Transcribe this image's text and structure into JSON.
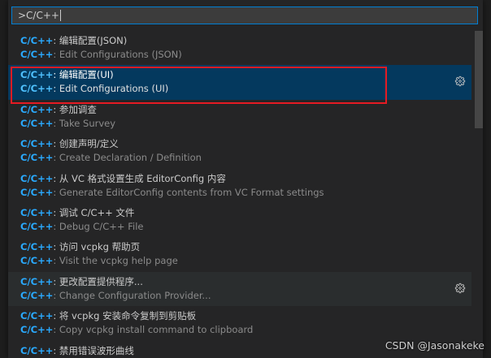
{
  "search": {
    "value": ">C/C++"
  },
  "items": [
    {
      "prefix": "C/C++",
      "title": ": 编辑配置(JSON)",
      "detail": ": Edit Configurations (JSON)",
      "state": "normal",
      "gear": false
    },
    {
      "prefix": "C/C++",
      "title": ": 编辑配置(UI)",
      "detail": ": Edit Configurations (UI)",
      "state": "selected",
      "gear": true
    },
    {
      "prefix": "C/C++",
      "title": ": 参加调查",
      "detail": ": Take Survey",
      "state": "normal",
      "gear": false
    },
    {
      "prefix": "C/C++",
      "title": ": 创建声明/定义",
      "detail": ": Create Declaration / Definition",
      "state": "normal",
      "gear": false
    },
    {
      "prefix": "C/C++",
      "title": ": 从 VC 格式设置生成 EditorConfig 内容",
      "detail": ": Generate EditorConfig contents from VC Format settings",
      "state": "normal",
      "gear": false
    },
    {
      "prefix": "C/C++",
      "title": ": 调试 C/C++ 文件",
      "detail": ": Debug C/C++ File",
      "state": "normal",
      "gear": false
    },
    {
      "prefix": "C/C++",
      "title": ": 访问 vcpkg 帮助页",
      "detail": ": Visit the vcpkg help page",
      "state": "normal",
      "gear": false
    },
    {
      "prefix": "C/C++",
      "title": ": 更改配置提供程序...",
      "detail": ": Change Configuration Provider...",
      "state": "hover",
      "gear": true
    },
    {
      "prefix": "C/C++",
      "title": ": 将 vcpkg 安装命令复制到剪贴板",
      "detail": ": Copy vcpkg install command to clipboard",
      "state": "normal",
      "gear": false
    },
    {
      "prefix": "C/C++",
      "title": ": 禁用错误波形曲线",
      "detail": "",
      "state": "normal",
      "gear": false
    }
  ],
  "watermark": "CSDN @Jasonakeke",
  "colors": {
    "accent": "#007fd4",
    "selected_bg": "#04395e",
    "highlight_text": "#2aaaff",
    "annotation_box": "#e51b23"
  },
  "icons": {
    "gear": "gear-icon"
  }
}
